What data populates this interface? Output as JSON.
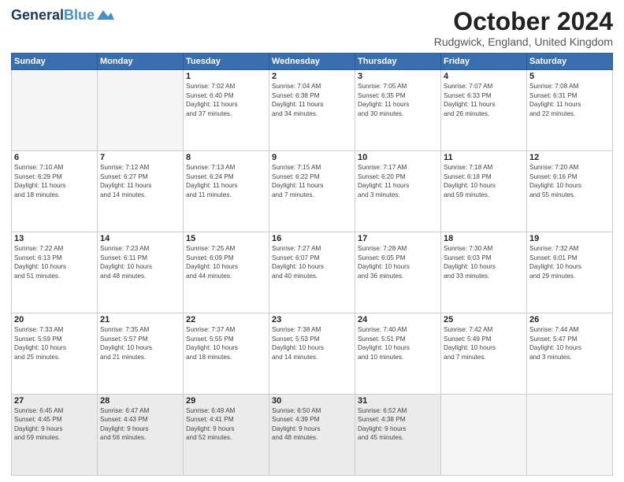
{
  "header": {
    "logo_line1": "General",
    "logo_line2": "Blue",
    "main_title": "October 2024",
    "subtitle": "Rudgwick, England, United Kingdom"
  },
  "days_of_week": [
    "Sunday",
    "Monday",
    "Tuesday",
    "Wednesday",
    "Thursday",
    "Friday",
    "Saturday"
  ],
  "weeks": [
    [
      {
        "day": "",
        "info": ""
      },
      {
        "day": "",
        "info": ""
      },
      {
        "day": "1",
        "info": "Sunrise: 7:02 AM\nSunset: 6:40 PM\nDaylight: 11 hours\nand 37 minutes."
      },
      {
        "day": "2",
        "info": "Sunrise: 7:04 AM\nSunset: 6:38 PM\nDaylight: 11 hours\nand 34 minutes."
      },
      {
        "day": "3",
        "info": "Sunrise: 7:05 AM\nSunset: 6:35 PM\nDaylight: 11 hours\nand 30 minutes."
      },
      {
        "day": "4",
        "info": "Sunrise: 7:07 AM\nSunset: 6:33 PM\nDaylight: 11 hours\nand 26 minutes."
      },
      {
        "day": "5",
        "info": "Sunrise: 7:08 AM\nSunset: 6:31 PM\nDaylight: 11 hours\nand 22 minutes."
      }
    ],
    [
      {
        "day": "6",
        "info": "Sunrise: 7:10 AM\nSunset: 6:29 PM\nDaylight: 11 hours\nand 18 minutes."
      },
      {
        "day": "7",
        "info": "Sunrise: 7:12 AM\nSunset: 6:27 PM\nDaylight: 11 hours\nand 14 minutes."
      },
      {
        "day": "8",
        "info": "Sunrise: 7:13 AM\nSunset: 6:24 PM\nDaylight: 11 hours\nand 11 minutes."
      },
      {
        "day": "9",
        "info": "Sunrise: 7:15 AM\nSunset: 6:22 PM\nDaylight: 11 hours\nand 7 minutes."
      },
      {
        "day": "10",
        "info": "Sunrise: 7:17 AM\nSunset: 6:20 PM\nDaylight: 11 hours\nand 3 minutes."
      },
      {
        "day": "11",
        "info": "Sunrise: 7:18 AM\nSunset: 6:18 PM\nDaylight: 10 hours\nand 59 minutes."
      },
      {
        "day": "12",
        "info": "Sunrise: 7:20 AM\nSunset: 6:16 PM\nDaylight: 10 hours\nand 55 minutes."
      }
    ],
    [
      {
        "day": "13",
        "info": "Sunrise: 7:22 AM\nSunset: 6:13 PM\nDaylight: 10 hours\nand 51 minutes."
      },
      {
        "day": "14",
        "info": "Sunrise: 7:23 AM\nSunset: 6:11 PM\nDaylight: 10 hours\nand 48 minutes."
      },
      {
        "day": "15",
        "info": "Sunrise: 7:25 AM\nSunset: 6:09 PM\nDaylight: 10 hours\nand 44 minutes."
      },
      {
        "day": "16",
        "info": "Sunrise: 7:27 AM\nSunset: 6:07 PM\nDaylight: 10 hours\nand 40 minutes."
      },
      {
        "day": "17",
        "info": "Sunrise: 7:28 AM\nSunset: 6:05 PM\nDaylight: 10 hours\nand 36 minutes."
      },
      {
        "day": "18",
        "info": "Sunrise: 7:30 AM\nSunset: 6:03 PM\nDaylight: 10 hours\nand 33 minutes."
      },
      {
        "day": "19",
        "info": "Sunrise: 7:32 AM\nSunset: 6:01 PM\nDaylight: 10 hours\nand 29 minutes."
      }
    ],
    [
      {
        "day": "20",
        "info": "Sunrise: 7:33 AM\nSunset: 5:59 PM\nDaylight: 10 hours\nand 25 minutes."
      },
      {
        "day": "21",
        "info": "Sunrise: 7:35 AM\nSunset: 5:57 PM\nDaylight: 10 hours\nand 21 minutes."
      },
      {
        "day": "22",
        "info": "Sunrise: 7:37 AM\nSunset: 5:55 PM\nDaylight: 10 hours\nand 18 minutes."
      },
      {
        "day": "23",
        "info": "Sunrise: 7:38 AM\nSunset: 5:53 PM\nDaylight: 10 hours\nand 14 minutes."
      },
      {
        "day": "24",
        "info": "Sunrise: 7:40 AM\nSunset: 5:51 PM\nDaylight: 10 hours\nand 10 minutes."
      },
      {
        "day": "25",
        "info": "Sunrise: 7:42 AM\nSunset: 5:49 PM\nDaylight: 10 hours\nand 7 minutes."
      },
      {
        "day": "26",
        "info": "Sunrise: 7:44 AM\nSunset: 5:47 PM\nDaylight: 10 hours\nand 3 minutes."
      }
    ],
    [
      {
        "day": "27",
        "info": "Sunrise: 6:45 AM\nSunset: 4:45 PM\nDaylight: 9 hours\nand 59 minutes."
      },
      {
        "day": "28",
        "info": "Sunrise: 6:47 AM\nSunset: 4:43 PM\nDaylight: 9 hours\nand 56 minutes."
      },
      {
        "day": "29",
        "info": "Sunrise: 6:49 AM\nSunset: 4:41 PM\nDaylight: 9 hours\nand 52 minutes."
      },
      {
        "day": "30",
        "info": "Sunrise: 6:50 AM\nSunset: 4:39 PM\nDaylight: 9 hours\nand 48 minutes."
      },
      {
        "day": "31",
        "info": "Sunrise: 6:52 AM\nSunset: 4:38 PM\nDaylight: 9 hours\nand 45 minutes."
      },
      {
        "day": "",
        "info": ""
      },
      {
        "day": "",
        "info": ""
      }
    ]
  ]
}
